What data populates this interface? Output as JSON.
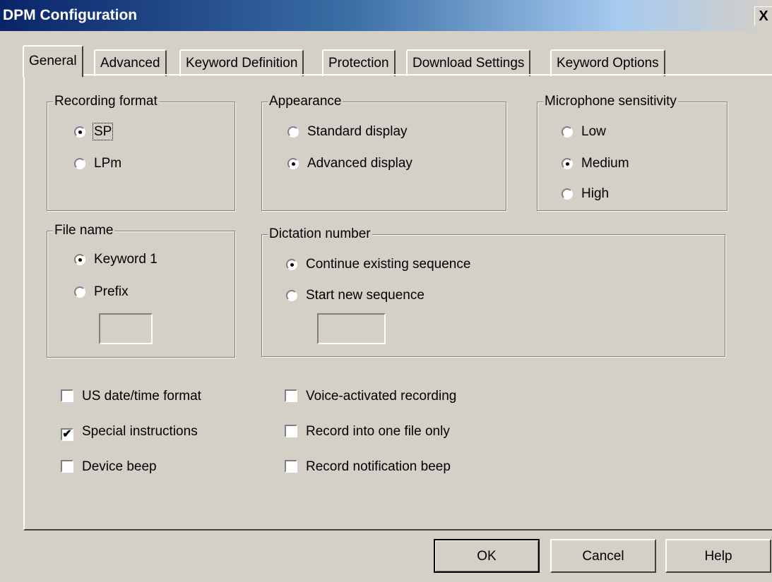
{
  "window": {
    "title": "DPM Configuration",
    "close_glyph": "X"
  },
  "tabs": [
    {
      "label": "General",
      "active": true
    },
    {
      "label": "Advanced"
    },
    {
      "label": "Keyword Definition"
    },
    {
      "label": "Protection"
    },
    {
      "label": "Download Settings"
    },
    {
      "label": "Keyword Options"
    }
  ],
  "recording_format": {
    "title": "Recording format",
    "options": [
      "SP",
      "LPm"
    ],
    "selected": "SP"
  },
  "appearance": {
    "title": "Appearance",
    "options": [
      "Standard display",
      "Advanced display"
    ],
    "selected": "Advanced display"
  },
  "mic_sensitivity": {
    "title": "Microphone sensitivity",
    "options": [
      "Low",
      "Medium",
      "High"
    ],
    "selected": "Medium"
  },
  "file_name": {
    "title": "File name",
    "options": [
      "Keyword 1",
      "Prefix"
    ],
    "selected": "Keyword 1",
    "prefix_value": ""
  },
  "dictation_number": {
    "title": "Dictation number",
    "options": [
      "Continue existing sequence",
      "Start new sequence"
    ],
    "selected": "Continue existing sequence",
    "start_value": ""
  },
  "checkboxes": {
    "us_date": {
      "label": "US date/time format",
      "checked": false
    },
    "special": {
      "label": "Special instructions",
      "checked": true
    },
    "device_beep": {
      "label": "Device beep",
      "checked": false
    },
    "voice_activated": {
      "label": "Voice-activated recording",
      "checked": false
    },
    "one_file": {
      "label": "Record into one file only",
      "checked": false
    },
    "notification_beep": {
      "label": "Record notification beep",
      "checked": false
    }
  },
  "check_glyph": "✔",
  "buttons": {
    "ok": "OK",
    "cancel": "Cancel",
    "help": "Help"
  }
}
